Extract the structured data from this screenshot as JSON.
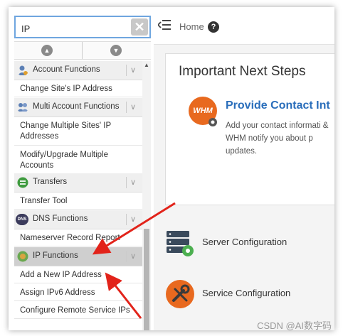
{
  "search": {
    "value": "IP"
  },
  "clear_symbol": "✕",
  "collapse": {
    "up": "▲",
    "down": "▼"
  },
  "scroll_up_symbol": "▲",
  "chevron_symbol": "∨",
  "sidebar": {
    "sections": [
      {
        "label": "Account Functions",
        "icon": "account-functions-icon",
        "items": [
          "Change Site's IP Address"
        ]
      },
      {
        "label": "Multi Account Functions",
        "icon": "multi-account-icon",
        "items": [
          "Change Multiple Sites' IP Addresses",
          "Modify/Upgrade Multiple Accounts"
        ]
      },
      {
        "label": "Transfers",
        "icon": "transfers-icon",
        "items": [
          "Transfer Tool"
        ]
      },
      {
        "label": "DNS Functions",
        "icon": "dns-icon",
        "items": [
          "Nameserver Record Report"
        ]
      },
      {
        "label": "IP Functions",
        "icon": "ip-functions-icon",
        "items": [
          "Add a New IP Address",
          "Assign IPv6 Address",
          "Configure Remote Service IPs"
        ]
      }
    ]
  },
  "topbar": {
    "home": "Home",
    "help": "?"
  },
  "main": {
    "title": "Important Next Steps",
    "contact_title": "Provide Contact Int",
    "contact_desc": "Add your contact informati & WHM notify you about p updates.",
    "whm_logo": "WHM",
    "server_config": "Server Configuration",
    "service_config": "Service Configuration"
  },
  "dns_badge": "DNS",
  "watermark": "CSDN @AI数字码",
  "colors": {
    "accent": "#2a6ebb",
    "whm_orange": "#e8691f",
    "arrow_red": "#e2231a",
    "active_section": "#cfcfcf"
  }
}
